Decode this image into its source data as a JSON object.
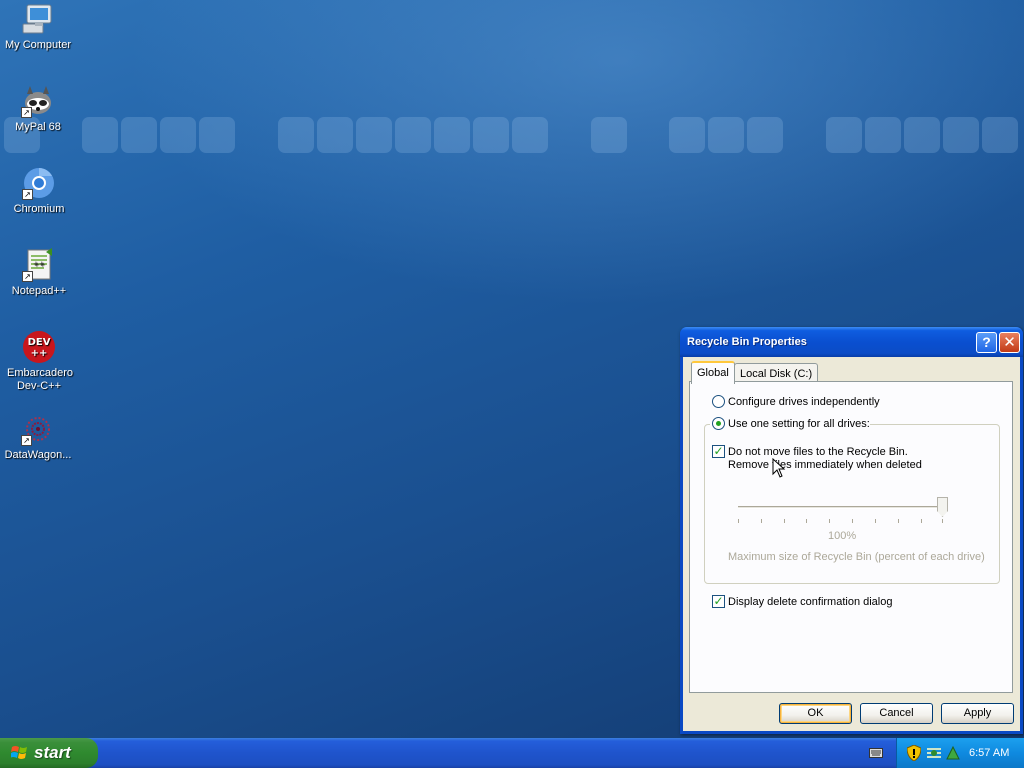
{
  "desktop": {
    "icons": [
      {
        "label": "My Computer",
        "icon": "my-computer-icon"
      },
      {
        "label": "MyPal 68",
        "icon": "mypal-icon"
      },
      {
        "label": "Chromium",
        "icon": "chromium-icon"
      },
      {
        "label": "Notepad++",
        "icon": "notepad-plus-plus-icon"
      },
      {
        "label": "Embarcadero Dev-C++",
        "icon": "dev-cpp-icon"
      },
      {
        "label": "DataWagon...",
        "icon": "datawagon-icon"
      }
    ],
    "dev_badge_top": "DEV",
    "dev_badge_bottom": "++"
  },
  "dialog": {
    "title": "Recycle Bin Properties",
    "help_glyph": "?",
    "close_glyph": "✕",
    "tabs": [
      {
        "label": "Global",
        "active": true
      },
      {
        "label": "Local Disk (C:)",
        "active": false
      }
    ],
    "radio_independent": "Configure drives independently",
    "radio_one_setting": "Use one setting for all drives:",
    "selected_radio": "one_setting",
    "no_recycle_line1": "Do not move files to the Recycle Bin.",
    "no_recycle_line2": "Remove files immediately when deleted",
    "no_recycle_checked": true,
    "slider_value": 1.0,
    "slider_percent_label": "100%",
    "slider_caption": "Maximum size of Recycle Bin (percent of each drive)",
    "confirm_label": "Display delete confirmation dialog",
    "confirm_checked": true,
    "buttons": {
      "ok": "OK",
      "cancel": "Cancel",
      "apply": "Apply"
    }
  },
  "taskbar": {
    "start_label": "start",
    "clock": "6:57 AM",
    "tray_icons": [
      "keyboard-icon",
      "security-shield-icon",
      "network-icon",
      "update-icon"
    ]
  }
}
